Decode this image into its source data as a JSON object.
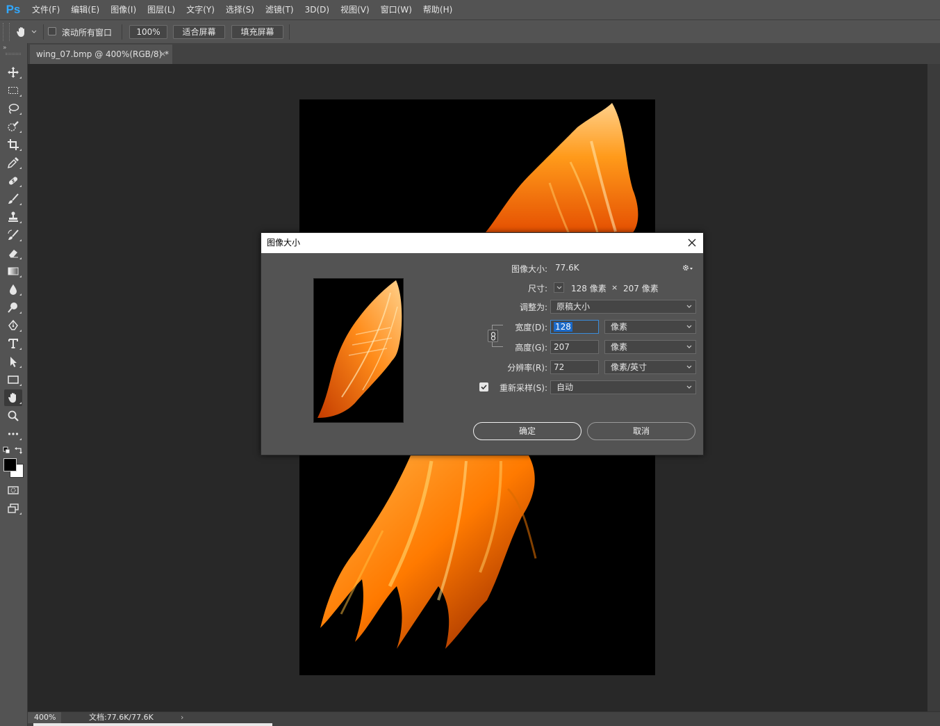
{
  "app": {
    "logo": "Ps"
  },
  "menu": [
    "文件(F)",
    "编辑(E)",
    "图像(I)",
    "图层(L)",
    "文字(Y)",
    "选择(S)",
    "滤镜(T)",
    "3D(D)",
    "视图(V)",
    "窗口(W)",
    "帮助(H)"
  ],
  "options": {
    "scroll_all_label": "滚动所有窗口",
    "zoom_value": "100%",
    "fit_screen_label": "适合屏幕",
    "fill_screen_label": "填充屏幕"
  },
  "tools": [
    "move-icon",
    "marquee-icon",
    "lasso-icon",
    "quick-select-icon",
    "crop-icon",
    "eyedropper-icon",
    "healing-brush-icon",
    "brush-icon",
    "stamp-icon",
    "history-brush-icon",
    "eraser-icon",
    "gradient-icon",
    "blur-icon",
    "dodge-icon",
    "pen-icon",
    "type-icon",
    "path-select-icon",
    "rectangle-icon",
    "hand-icon",
    "zoom-icon",
    "more-icon"
  ],
  "document": {
    "tab_title": "wing_07.bmp @ 400%(RGB/8) *",
    "tab_close": "×"
  },
  "status": {
    "zoom": "400%",
    "doc_info": "文档:77.6K/77.6K",
    "arrow": "›"
  },
  "dialog": {
    "title": "图像大小",
    "image_size_label": "图像大小:",
    "image_size_value": "77.6K",
    "dimensions_label": "尺寸:",
    "dimensions_width": "128 像素",
    "dimensions_x": "×",
    "dimensions_height": "207 像素",
    "fit_to_label": "调整为:",
    "fit_to_value": "原稿大小",
    "width_label": "宽度(D):",
    "width_value": "128",
    "width_unit": "像素",
    "height_label": "高度(G):",
    "height_value": "207",
    "height_unit": "像素",
    "resolution_label": "分辨率(R):",
    "resolution_value": "72",
    "resolution_unit": "像素/英寸",
    "resample_label": "重新采样(S):",
    "resample_checked": true,
    "resample_value": "自动",
    "ok_label": "确定",
    "cancel_label": "取消"
  },
  "colors": {
    "accent": "#31a8ff",
    "panel": "#535353",
    "canvas_bg": "#282828",
    "selection": "#1b6ac9"
  }
}
